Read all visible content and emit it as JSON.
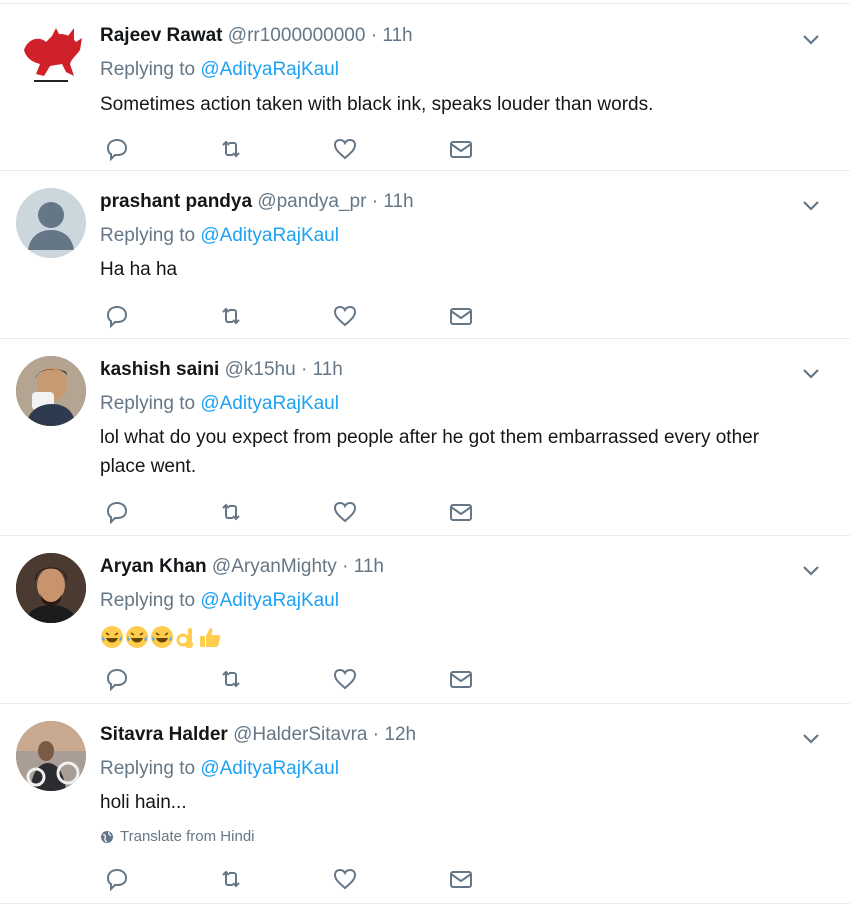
{
  "tweets": [
    {
      "fullname": "Rajeev Rawat",
      "username": "@rr1000000000",
      "time": "11h",
      "replying_prefix": "Replying to",
      "replying_to": "@AdityaRajKaul",
      "text": "Sometimes action taken with black ink, speaks louder than words.",
      "avatar_icon": "red-bull-logo"
    },
    {
      "fullname": "prashant pandya",
      "username": "@pandya_pr",
      "time": "11h",
      "replying_prefix": "Replying to",
      "replying_to": "@AdityaRajKaul",
      "text": "Ha ha ha",
      "avatar_icon": "default-profile"
    },
    {
      "fullname": "kashish saini",
      "username": "@k15hu",
      "time": "11h",
      "replying_prefix": "Replying to",
      "replying_to": "@AdityaRajKaul",
      "text_line1": "lol what do you expect from people after he got them embarrassed every other",
      "text_line2": "place went.",
      "avatar_icon": "user-photo"
    },
    {
      "fullname": "Aryan Khan",
      "username": "@AryanMighty",
      "time": "11h",
      "replying_prefix": "Replying to",
      "replying_to": "@AdityaRajKaul",
      "emojis": [
        "face-with-tears-of-joy",
        "face-with-tears-of-joy",
        "face-with-tears-of-joy",
        "ok-hand",
        "thumbs-up"
      ],
      "avatar_icon": "user-photo"
    },
    {
      "fullname": "Sitavra Halder",
      "username": "@HalderSitavra",
      "time": "12h",
      "replying_prefix": "Replying to",
      "replying_to": "@AdityaRajKaul",
      "text": "holi hain...",
      "translate": "Translate from Hindi",
      "avatar_icon": "user-photo"
    }
  ],
  "dot": "·",
  "colors": {
    "link": "#1da1f2",
    "muted": "#657786",
    "text": "#14171a",
    "divider": "#e6ecf0"
  }
}
